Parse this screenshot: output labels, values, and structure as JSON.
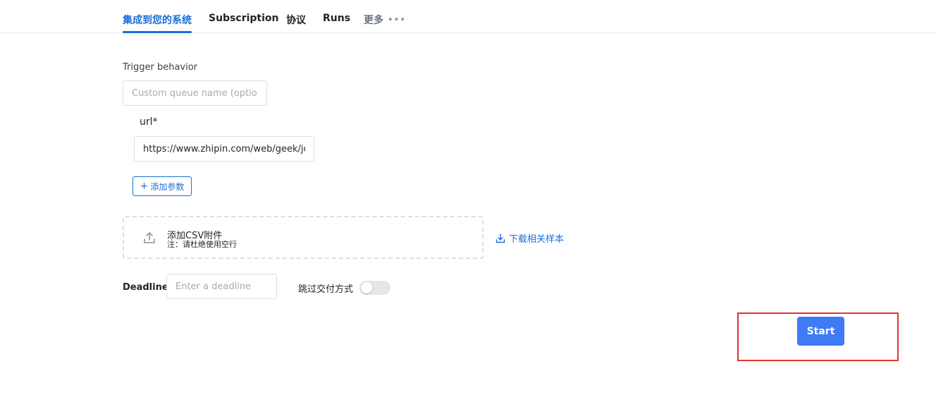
{
  "tabs": [
    {
      "label": "集成到您的系统",
      "active": true
    },
    {
      "label": "Subscription",
      "active": false
    },
    {
      "label": "协议",
      "active": false
    },
    {
      "label": "Runs",
      "active": false
    },
    {
      "label": "更多",
      "active": false
    }
  ],
  "form": {
    "trigger_label": "Trigger behavior",
    "queue_placeholder": "Custom queue name (optional)",
    "url_label": "url*",
    "url_value": "https://www.zhipin.com/web/geek/job",
    "add_param_label": "添加参数",
    "upload_title": "添加CSV附件",
    "upload_note": "注：请杜绝使用空行",
    "download_label": "下载相关样本",
    "deadline_label": "Deadline",
    "deadline_placeholder": "Enter a deadline",
    "skip_label": "跳过交付方式",
    "skip_enabled": false,
    "start_label": "Start"
  },
  "colors": {
    "accent": "#1a6fd8",
    "start_button": "#3e7bf5",
    "highlight": "#e5322d"
  },
  "icons": {
    "more": "more-dots-icon",
    "upload": "upload-icon",
    "download": "download-icon",
    "add": "plus-icon"
  }
}
